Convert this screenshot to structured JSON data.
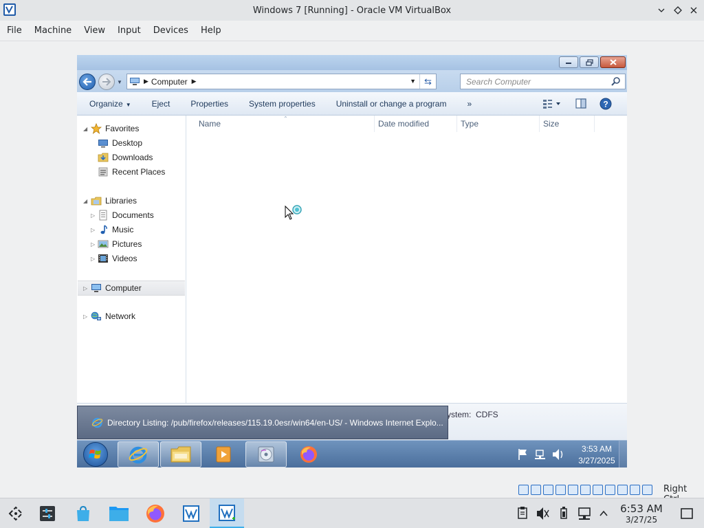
{
  "host_window": {
    "title": "Windows 7 [Running] - Oracle VM VirtualBox",
    "menu": [
      "File",
      "Machine",
      "View",
      "Input",
      "Devices",
      "Help"
    ],
    "host_key_label": "Right Ctrl"
  },
  "explorer": {
    "breadcrumb": "Computer",
    "search_placeholder": "Search Computer",
    "commands": {
      "organize": "Organize",
      "eject": "Eject",
      "properties": "Properties",
      "system_properties": "System properties",
      "uninstall": "Uninstall or change a program",
      "more": "»"
    },
    "nav": {
      "favorites": "Favorites",
      "desktop": "Desktop",
      "downloads": "Downloads",
      "recent_places": "Recent Places",
      "libraries": "Libraries",
      "documents": "Documents",
      "music": "Music",
      "pictures": "Pictures",
      "videos": "Videos",
      "computer": "Computer",
      "network": "Network"
    },
    "columns": {
      "name": "Name",
      "date_modified": "Date modified",
      "type": "Type",
      "size": "Size"
    },
    "details_pane": {
      "filesystem_label": "ystem:",
      "filesystem_value": "CDFS"
    }
  },
  "tooltip": {
    "text": "Directory Listing: /pub/firefox/releases/115.19.0esr/win64/en-US/ - Windows Internet Explo..."
  },
  "guest_clock": {
    "time": "3:53 AM",
    "date": "3/27/2025"
  },
  "host_clock": {
    "time": "6:53 AM",
    "date": "3/27/25"
  },
  "colors": {
    "accent": "#3daee9",
    "win7_taskbar": "#5b7fac",
    "explorer_text": "#1e395b"
  }
}
